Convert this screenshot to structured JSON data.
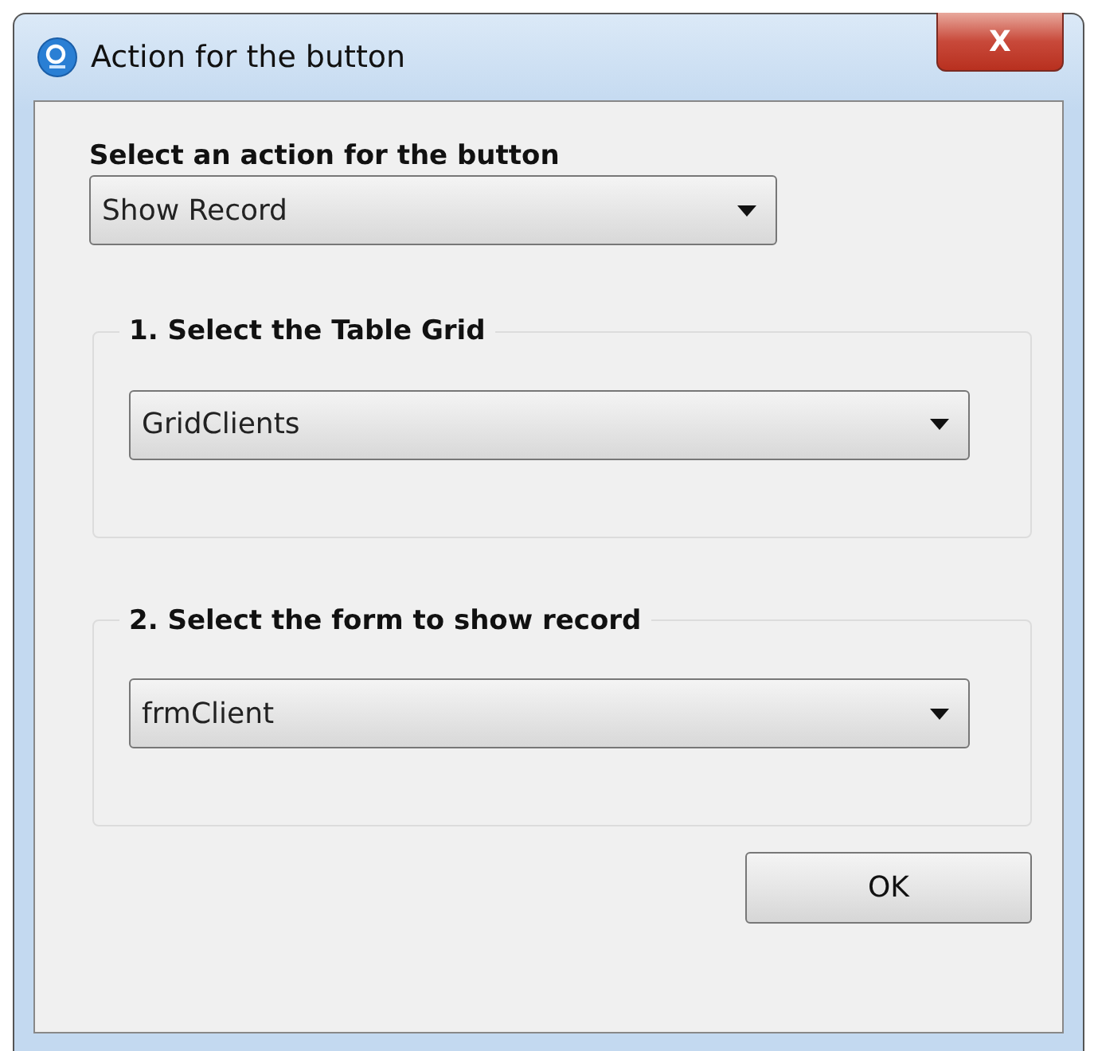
{
  "window": {
    "title": "Action for the button",
    "close": "X"
  },
  "action": {
    "label": "Select an action for the button",
    "value": "Show Record"
  },
  "groups": [
    {
      "title": "1. Select the Table Grid",
      "value": "GridClients"
    },
    {
      "title": "2. Select the form to show record",
      "value": "frmClient"
    }
  ],
  "buttons": [
    "OK"
  ]
}
